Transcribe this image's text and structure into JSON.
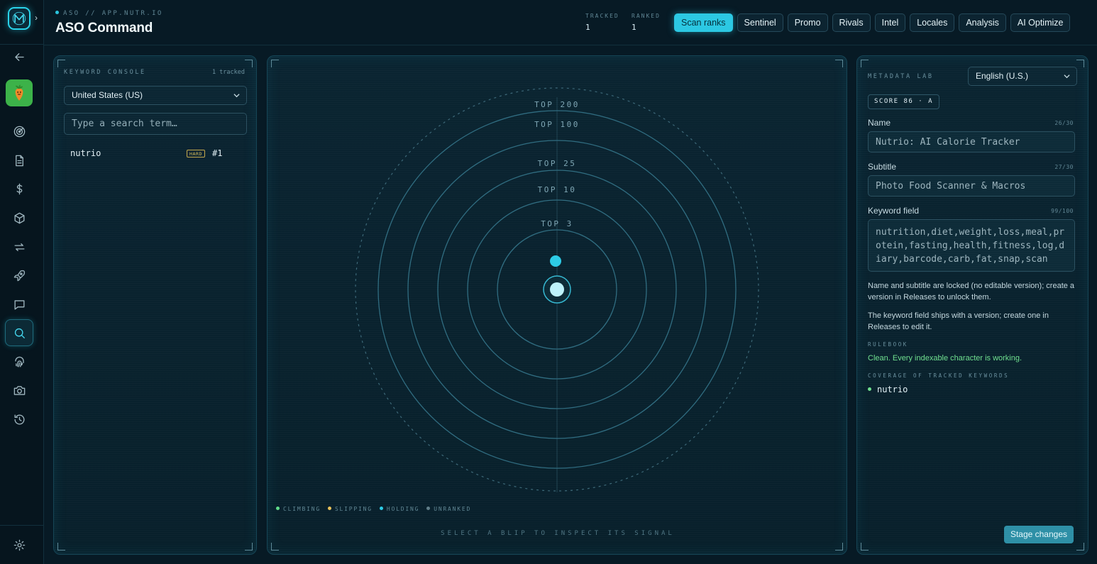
{
  "app": {
    "crumb": "ASO // APP.NUTR.IO",
    "title": "ASO Command"
  },
  "stats": [
    {
      "label": "TRACKED",
      "value": "1"
    },
    {
      "label": "RANKED",
      "value": "1"
    }
  ],
  "actions": [
    "Scan ranks",
    "Sentinel",
    "Promo",
    "Rivals",
    "Intel",
    "Locales",
    "Analysis",
    "AI Optimize"
  ],
  "sidebar": {
    "active": "search",
    "icons": [
      "radar-icon",
      "document-icon",
      "dollar-icon",
      "cube-icon",
      "swap-icon",
      "rocket-icon",
      "chat-icon",
      "search-icon",
      "fingerprint-icon",
      "camera-icon",
      "history-icon"
    ],
    "bottom": "gear-icon"
  },
  "keyword_console": {
    "title": "KEYWORD CONSOLE",
    "tracked": "1 tracked",
    "country": "United States (US)",
    "search_placeholder": "Type a search term…",
    "keywords": [
      {
        "term": "nutrio",
        "difficulty": "HARD",
        "rank": "#1"
      }
    ]
  },
  "radar": {
    "rings": [
      "TOP 200",
      "TOP 100",
      "TOP 25",
      "TOP 10",
      "TOP 3"
    ],
    "legend": [
      {
        "label": "CLIMBING",
        "color": "#5fdc8a"
      },
      {
        "label": "SLIPPING",
        "color": "#e8c25a"
      },
      {
        "label": "HOLDING",
        "color": "#2ccbe6"
      },
      {
        "label": "UNRANKED",
        "color": "#5f7d88"
      }
    ],
    "hint": "SELECT A BLIP TO INSPECT ITS SIGNAL"
  },
  "metadata_lab": {
    "title": "METADATA LAB",
    "locale": "English (U.S.)",
    "score": "SCORE 86 · A",
    "name_label": "Name",
    "name_count": "26/30",
    "name_value": "Nutrio: AI Calorie Tracker",
    "subtitle_label": "Subtitle",
    "subtitle_count": "27/30",
    "subtitle_value": "Photo Food Scanner & Macros",
    "keyword_label": "Keyword field",
    "keyword_count": "99/100",
    "keyword_value": "nutrition,diet,weight,loss,meal,protein,fasting,health,fitness,log,diary,barcode,carb,fat,snap,scan",
    "note1": "Name and subtitle are locked (no editable version); create a version in Releases to unlock them.",
    "note2": "The keyword field ships with a version; create one in Releases to edit it.",
    "rulebook_label": "RULEBOOK",
    "rulebook_text": "Clean. Every indexable character is working.",
    "coverage_label": "COVERAGE OF TRACKED KEYWORDS",
    "coverage": [
      "nutrio"
    ],
    "stage_button": "Stage changes"
  }
}
